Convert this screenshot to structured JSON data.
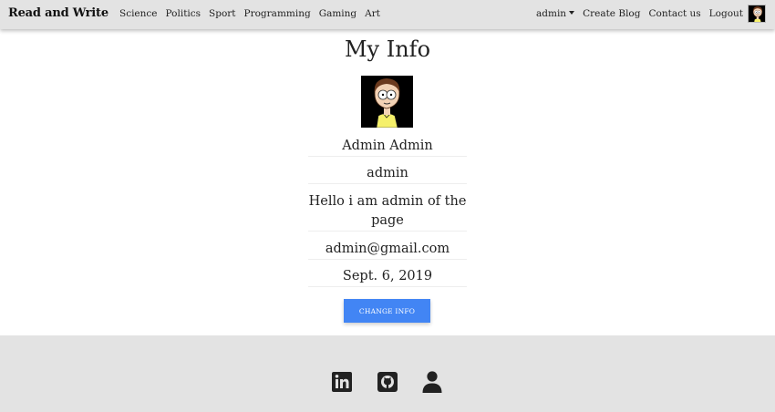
{
  "navbar": {
    "brand": "Read and Write",
    "categories": [
      "Science",
      "Politics",
      "Sport",
      "Programming",
      "Gaming",
      "Art"
    ],
    "user_menu": "admin",
    "links": [
      "Create Blog",
      "Contact us",
      "Logout"
    ],
    "avatar_icon": "morty-avatar-icon"
  },
  "profile": {
    "title": "My Info",
    "avatar_icon": "morty-avatar-icon",
    "full_name": "Admin Admin",
    "username": "admin",
    "bio": "Hello i am admin of the page",
    "email": "admin@gmail.com",
    "date": "Sept. 6, 2019",
    "button_label": "CHANGE INFO",
    "button_color": "#4285f4"
  },
  "footer": {
    "icons": [
      "linkedin-icon",
      "github-icon",
      "user-icon"
    ]
  }
}
